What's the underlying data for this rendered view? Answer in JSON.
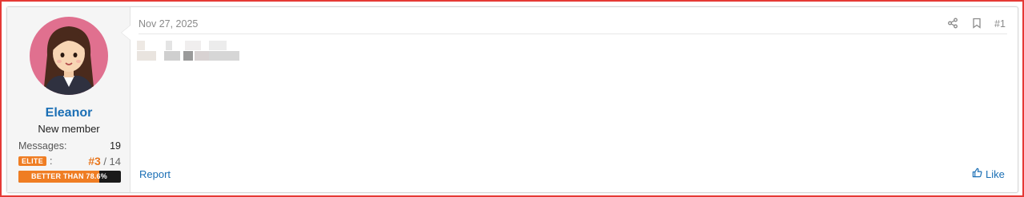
{
  "post": {
    "date": "Nov 27, 2025",
    "number": "#1",
    "report_label": "Report",
    "like_label": "Like"
  },
  "user": {
    "name": "Eleanor",
    "title": "New member",
    "messages_label": "Messages:",
    "messages_count": "19",
    "badge_label": "ELITE",
    "badge_separator": ":",
    "rank": "#3",
    "rank_total": "/ 14",
    "progress_label": "BETTER THAN 78.6%",
    "progress_value": 0.786
  },
  "icons": {
    "share": "share-icon",
    "bookmark": "bookmark-icon",
    "like": "thumbs-up-icon"
  },
  "colors": {
    "link": "#1b6fb5",
    "accent": "#ef7d23",
    "avatar_bg": "#e0708f",
    "frame_border": "#e53935"
  }
}
